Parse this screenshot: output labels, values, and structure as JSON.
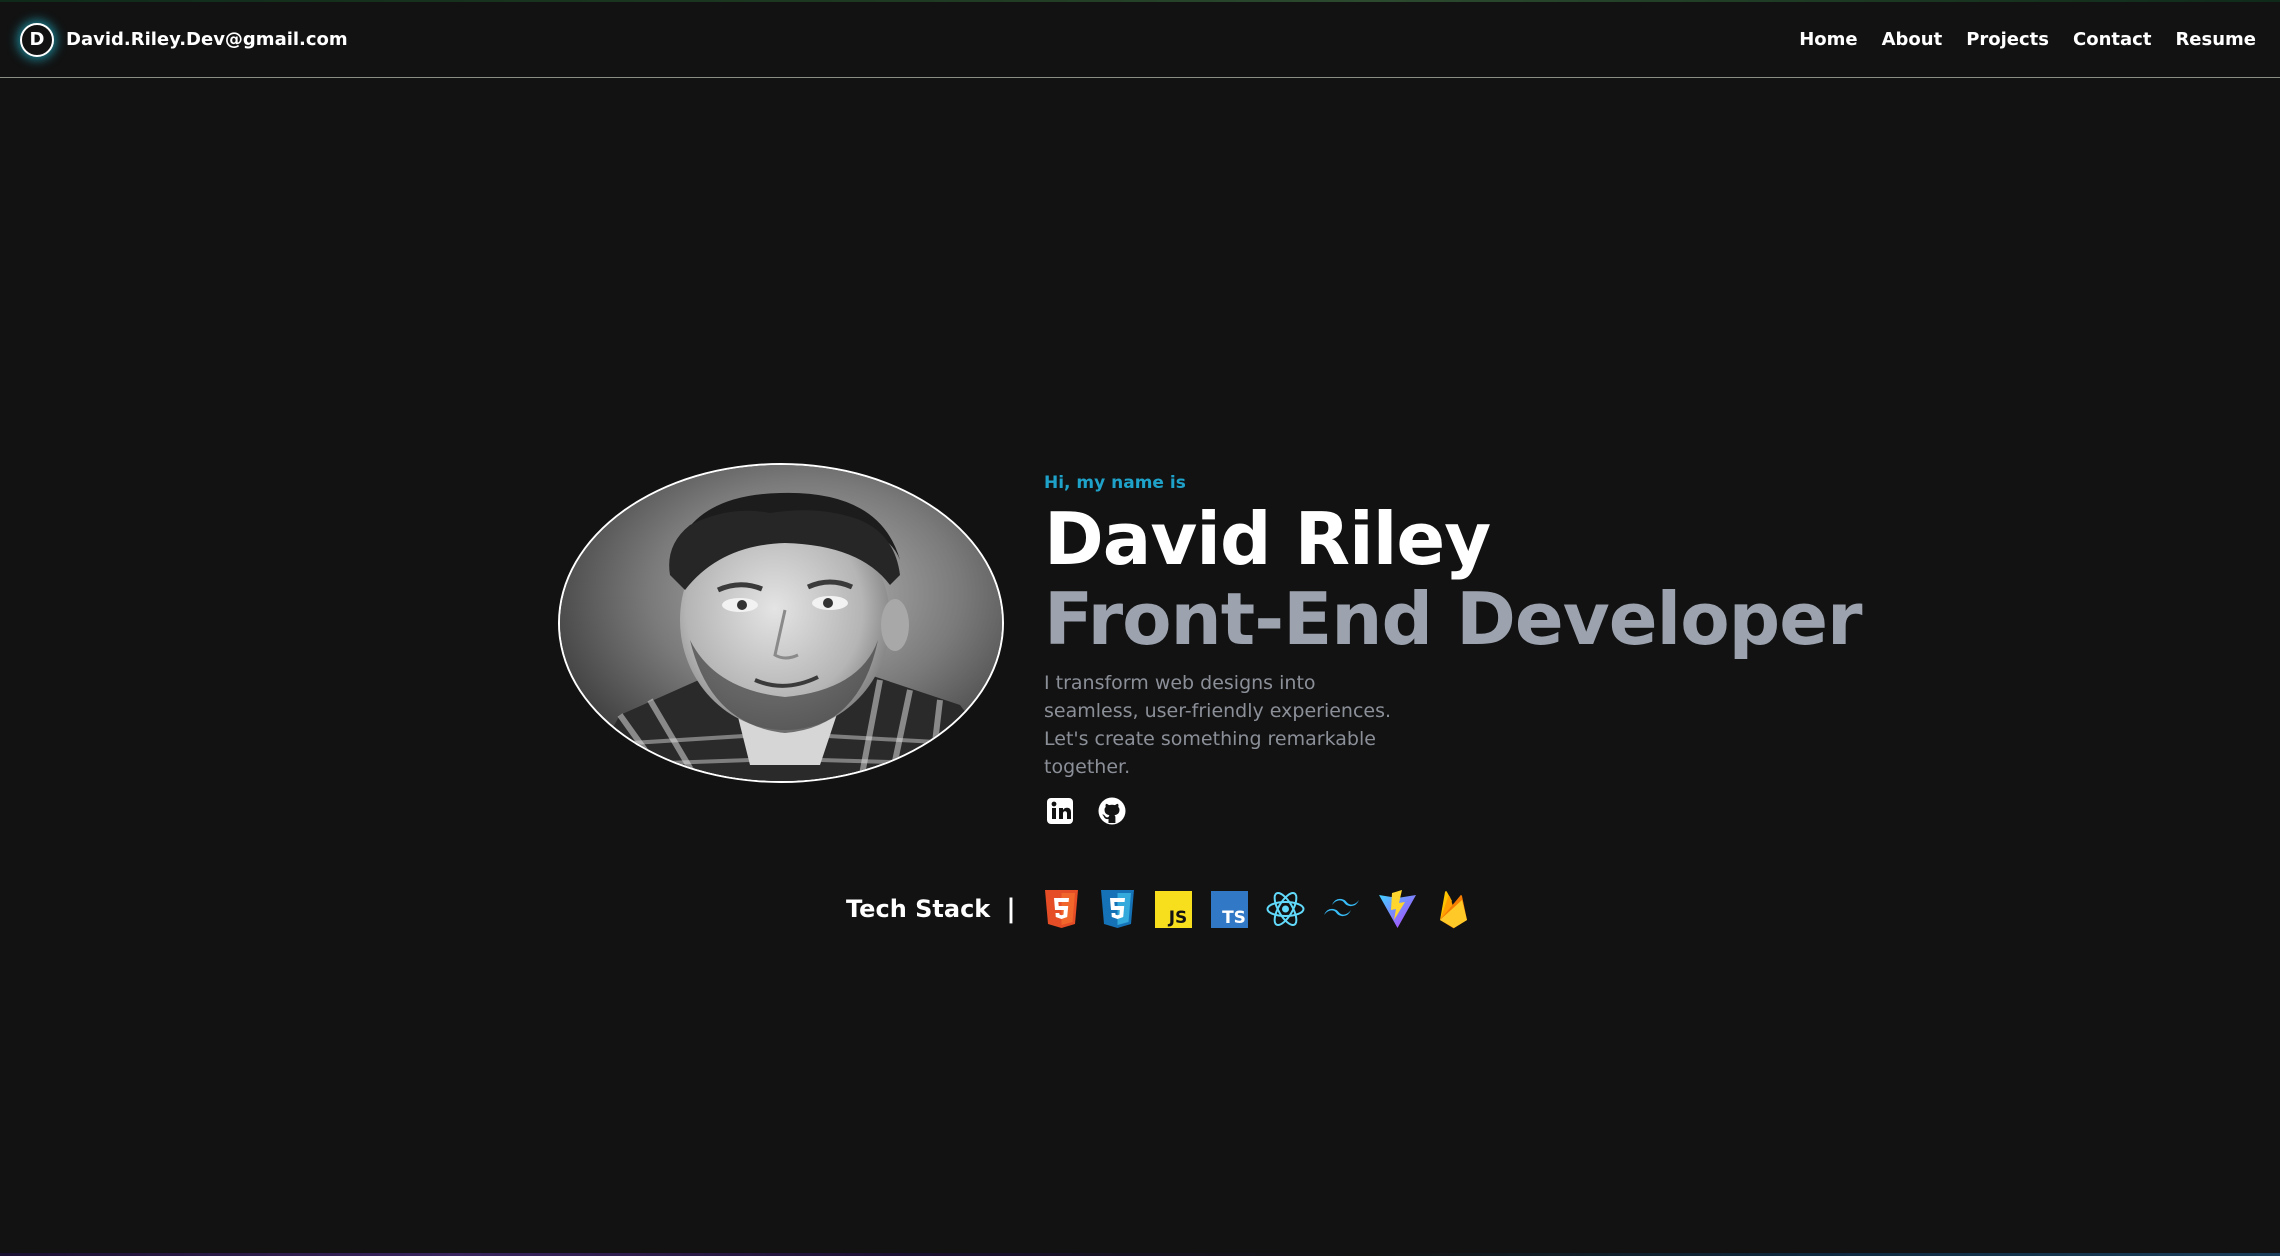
{
  "header": {
    "logo_letter": "D",
    "email": "David.Riley.Dev@gmail.com",
    "nav": [
      "Home",
      "About",
      "Projects",
      "Contact",
      "Resume"
    ]
  },
  "hero": {
    "greeting": "Hi, my name is",
    "name": "David Riley",
    "role": "Front-End Developer",
    "blurb": "I transform web designs into seamless, user-friendly experiences. Let's create something remarkable together.",
    "socials": [
      "linkedin-icon",
      "github-icon"
    ]
  },
  "tech_stack": {
    "label": "Tech Stack",
    "separator": "|",
    "icons": [
      "html5-icon",
      "css3-icon",
      "javascript-icon",
      "typescript-icon",
      "react-icon",
      "tailwind-icon",
      "vite-icon",
      "firebase-icon"
    ],
    "js_text": "JS",
    "ts_text": "TS"
  },
  "colors": {
    "background": "#121212",
    "accent": "#1fa2c9",
    "role_gray": "#9ca3af"
  }
}
